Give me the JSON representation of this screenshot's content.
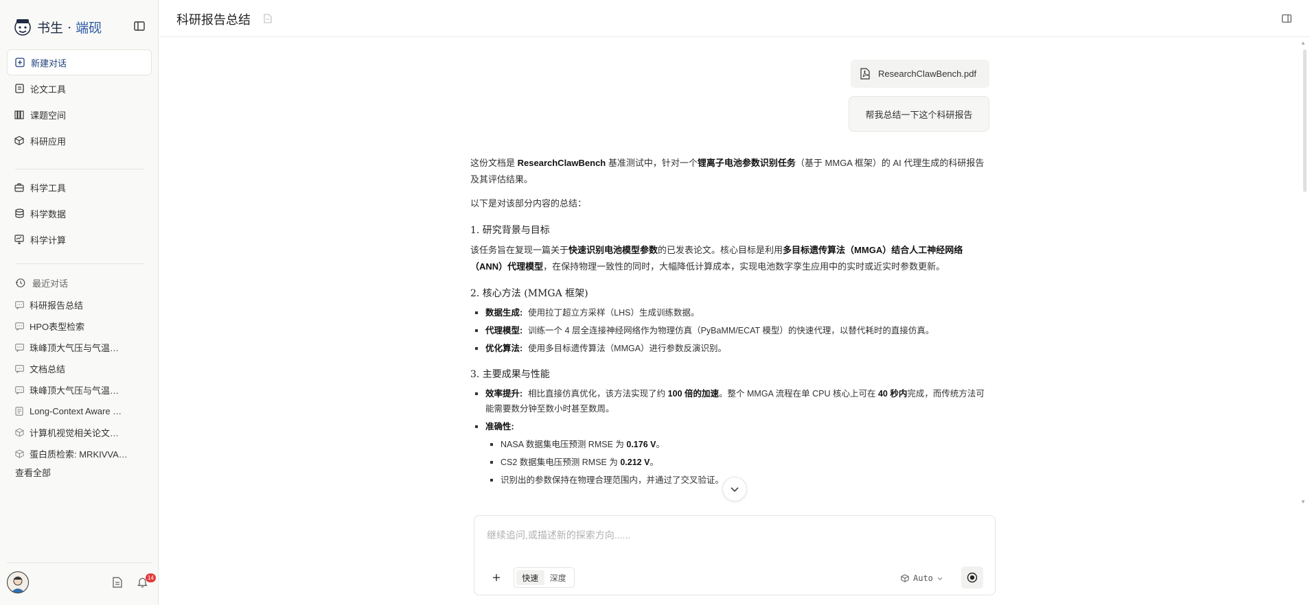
{
  "brand": {
    "name_main": "书生",
    "name_dot": "·",
    "name_accent": "端砚"
  },
  "nav": {
    "primary": [
      {
        "label": "新建对话",
        "icon": "plus-square-icon",
        "active": true
      },
      {
        "label": "论文工具",
        "icon": "document-icon"
      },
      {
        "label": "课题空间",
        "icon": "books-icon"
      },
      {
        "label": "科研应用",
        "icon": "cube-icon"
      }
    ],
    "secondary": [
      {
        "label": "科学工具",
        "icon": "toolbox-icon"
      },
      {
        "label": "科学数据",
        "icon": "database-icon"
      },
      {
        "label": "科学计算",
        "icon": "monitor-icon"
      }
    ]
  },
  "recent": {
    "heading": "最近对话",
    "items": [
      {
        "label": "科研报告总结",
        "icon": "chat-icon"
      },
      {
        "label": "HPO表型检索",
        "icon": "chat-icon"
      },
      {
        "label": "珠峰顶大气压与气温…",
        "icon": "chat-icon"
      },
      {
        "label": "文档总结",
        "icon": "chat-icon"
      },
      {
        "label": "珠峰顶大气压与气温…",
        "icon": "chat-icon"
      },
      {
        "label": "Long-Context Aware …",
        "icon": "document-icon"
      },
      {
        "label": "计算机视觉相关论文…",
        "icon": "cube-icon"
      },
      {
        "label": "蛋白质检索: MRKIVVA…",
        "icon": "cube-icon"
      }
    ],
    "view_all": "查看全部"
  },
  "notifications": {
    "count": "14"
  },
  "header": {
    "title": "科研报告总结"
  },
  "conversation": {
    "file_name": "ResearchClawBench.pdf",
    "user_message": "帮我总结一下这个科研报告",
    "answer": {
      "intro_1": "这份文档是",
      "intro_b1": "ResearchClawBench",
      "intro_2": "基准测试中，针对一个",
      "intro_b2": "锂离子电池参数识别任务",
      "intro_3": "（基于 MMGA 框架）的 AI 代理生成的科研报告及其评估结果。",
      "lead": "以下是对该部分内容的总结：",
      "s1_title": "1. 研究背景与目标",
      "s1_p1": "该任务旨在复现一篇关于",
      "s1_b1": "快速识别电池模型参数",
      "s1_p2": "的已发表论文。核心目标是利用",
      "s1_b2": "多目标遗传算法（MMGA）结合人工神经网络（ANN）代理模型",
      "s1_p3": "，在保持物理一致性的同时，大幅降低计算成本，实现电池数字孪生应用中的实时或近实时参数更新。",
      "s2_title": "2. 核心方法 (MMGA 框架)",
      "s2_items": [
        {
          "label": "数据生成:",
          "text": "使用拉丁超立方采样（LHS）生成训练数据。"
        },
        {
          "label": "代理模型:",
          "text": "训练一个 4 层全连接神经网络作为物理仿真（PyBaMM/ECAT 模型）的快速代理，以替代耗时的直接仿真。"
        },
        {
          "label": "优化算法:",
          "text": "使用多目标遗传算法（MMGA）进行参数反演识别。"
        }
      ],
      "s3_title": "3. 主要成果与性能",
      "s3_eff_label": "效率提升:",
      "s3_eff_1": "相比直接仿真优化，该方法实现了约",
      "s3_eff_b1": "100 倍的加速",
      "s3_eff_2": "。整个 MMGA 流程在单 CPU 核心上可在",
      "s3_eff_b2": "40 秒内",
      "s3_eff_3": "完成，而传统方法可能需要数分钟至数小时甚至数周。",
      "s3_acc_label": "准确性:",
      "s3_acc_1a": "NASA 数据集电压预测 RMSE 为",
      "s3_acc_1b": "0.176 V",
      "s3_acc_2a": "CS2 数据集电压预测 RMSE 为",
      "s3_acc_2b": "0.212 V",
      "s3_acc_end": "。",
      "s3_acc_3": "识别出的参数保持在物理合理范围内，并通过了交叉验证。"
    }
  },
  "composer": {
    "placeholder": "继续追问,或描述新的探索方向......",
    "mode_fast": "快速",
    "mode_deep": "深度",
    "model": "Auto"
  }
}
